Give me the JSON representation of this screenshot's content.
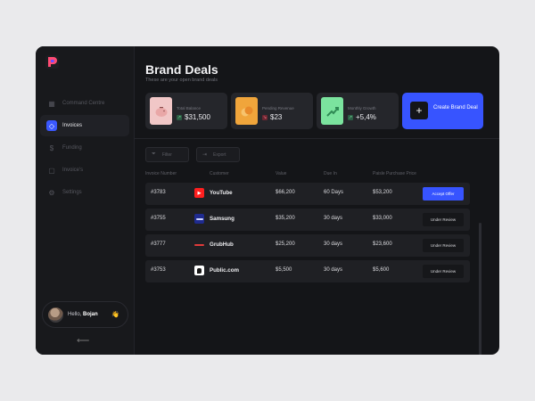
{
  "nav": [
    {
      "label": "Command Centre",
      "icon": "grid-icon"
    },
    {
      "label": "Invoices",
      "icon": "tag-icon",
      "active": true
    },
    {
      "label": "Funding",
      "icon": "dollar-icon"
    },
    {
      "label": "Invoice's",
      "icon": "bag-icon"
    },
    {
      "label": "Settings",
      "icon": "gear-icon"
    }
  ],
  "user": {
    "hello": "Hello,",
    "name": "Bojan",
    "wave": "👋"
  },
  "page": {
    "title": "Brand Deals",
    "subtitle": "These are your open brand deals"
  },
  "stats": [
    {
      "label": "Total Balance",
      "value": "$31,500",
      "trend": "up",
      "trend_glyph": "↗"
    },
    {
      "label": "Pending Revenue",
      "value": "$23",
      "trend": "down",
      "trend_glyph": "↘"
    },
    {
      "label": "Monthly Growth",
      "value": "+5,4%",
      "trend": "up",
      "trend_glyph": "↗"
    }
  ],
  "create": {
    "label": "Create Brand Deal",
    "icon": "+"
  },
  "tools": {
    "filter": "Filter",
    "export": "Export"
  },
  "table": {
    "headers": [
      "Invoice Number",
      "Customer",
      "Value",
      "Due In",
      "Paisle Purchase Price"
    ],
    "rows": [
      {
        "invoice": "#3783",
        "customer": "YouTube",
        "value": "$66,200",
        "due": "60 Days",
        "price": "$53,200",
        "action": "Accept Offer",
        "primary": true
      },
      {
        "invoice": "#3755",
        "customer": "Samsung",
        "value": "$35,200",
        "due": "30 days",
        "price": "$33,000",
        "action": "Under Review",
        "primary": false
      },
      {
        "invoice": "#3777",
        "customer": "GrubHub",
        "value": "$25,200",
        "due": "30 days",
        "price": "$23,600",
        "action": "Under Review",
        "primary": false
      },
      {
        "invoice": "#3753",
        "customer": "Public.com",
        "value": "$5,500",
        "due": "30 days",
        "price": "$5,600",
        "action": "Under Review",
        "primary": false
      }
    ]
  },
  "colors": {
    "accent": "#3754ff",
    "background": "#141518"
  }
}
